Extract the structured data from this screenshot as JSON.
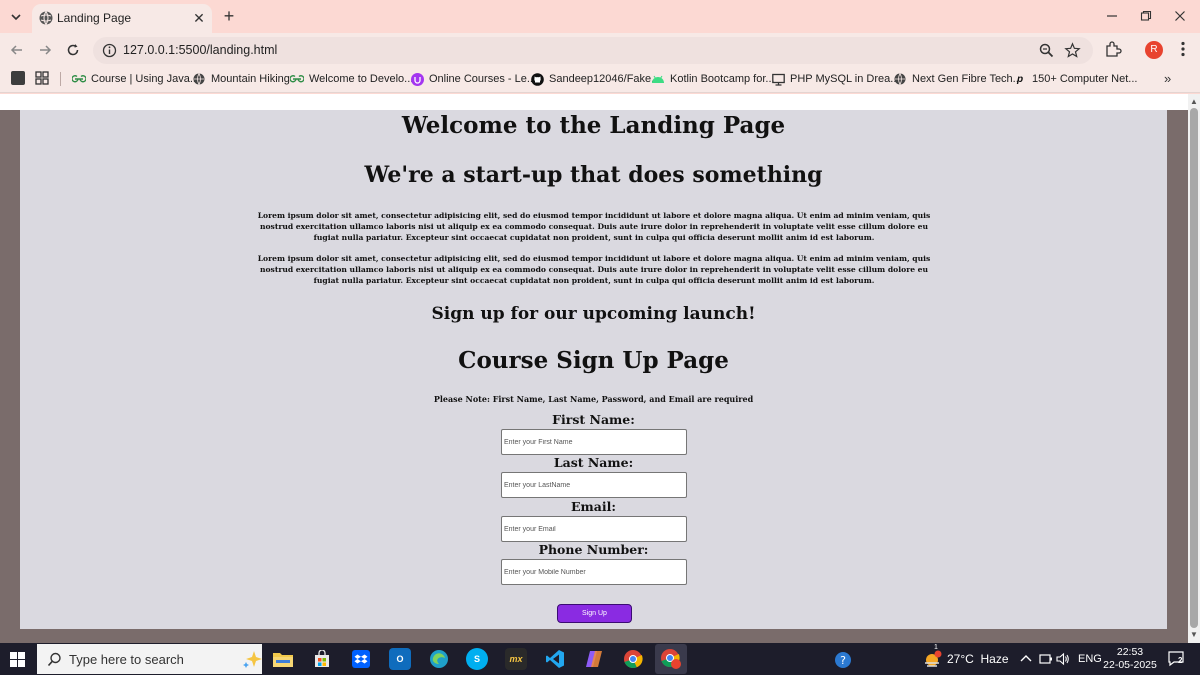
{
  "browser": {
    "tab": {
      "title": "Landing Page"
    },
    "url": "127.0.0.1:5500/landing.html",
    "profile_initial": "R",
    "bookmarks": [
      {
        "label": "Course | Using Java...",
        "icon": "gfg-icon",
        "color": "#2f8d46"
      },
      {
        "label": "Mountain Hiking",
        "icon": "globe-icon",
        "color": "#333333"
      },
      {
        "label": "Welcome to Develo...",
        "icon": "gfg-icon",
        "color": "#2f8d46"
      },
      {
        "label": "Online Courses - Le...",
        "icon": "udemy-icon",
        "color": "#a435f0"
      },
      {
        "label": "Sandeep12046/Fake...",
        "icon": "github-icon",
        "color": "#111111"
      },
      {
        "label": "Kotlin Bootcamp for...",
        "icon": "android-icon",
        "color": "#3ddc84"
      },
      {
        "label": "PHP MySQL in Drea...",
        "icon": "monitor-icon",
        "color": "#333333"
      },
      {
        "label": "Next Gen Fibre Tech...",
        "icon": "globe-icon",
        "color": "#333333"
      },
      {
        "label": "150+ Computer Net...",
        "icon": "p-icon",
        "color": "#111111"
      }
    ],
    "more_bookmarks": "»"
  },
  "page": {
    "heading": "Welcome to the Landing Page",
    "subheading": "We're a start-up that does something",
    "paragraphs": [
      "Lorem ipsum dolor sit amet, consectetur adipisicing elit, sed do eiusmod tempor incididunt ut labore et dolore magna aliqua. Ut enim ad minim veniam, quis nostrud exercitation ullamco laboris nisi ut aliquip ex ea commodo consequat. Duis aute irure dolor in reprehenderit in voluptate velit esse cillum dolore eu fugiat nulla pariatur. Excepteur sint occaecat cupidatat non proident, sunt in culpa qui officia deserunt mollit anim id est laborum.",
      "Lorem ipsum dolor sit amet, consectetur adipisicing elit, sed do eiusmod tempor incididunt ut labore et dolore magna aliqua. Ut enim ad minim veniam, quis nostrud exercitation ullamco laboris nisi ut aliquip ex ea commodo consequat. Duis aute irure dolor in reprehenderit in voluptate velit esse cillum dolore eu fugiat nulla pariatur. Excepteur sint occaecat cupidatat non proident, sunt in culpa qui officia deserunt mollit anim id est laborum."
    ],
    "cta": "Sign up for our upcoming launch!",
    "form_title": "Course Sign Up Page",
    "note": "Please Note: First Name, Last Name, Password, and Email are required",
    "fields": [
      {
        "label": "First Name:",
        "placeholder": "Enter your First Name"
      },
      {
        "label": "Last Name:",
        "placeholder": "Enter your LastName"
      },
      {
        "label": "Email:",
        "placeholder": "Enter your Email"
      },
      {
        "label": "Phone Number:",
        "placeholder": "Enter your Mobile Number"
      }
    ],
    "submit_label": "Sign Up",
    "colors": {
      "background": "#dad9e0",
      "button": "#8a2be2"
    }
  },
  "taskbar": {
    "search_placeholder": "Type here to search",
    "apps": [
      {
        "name": "file-explorer-icon",
        "label": "",
        "color": "#f2c94c"
      },
      {
        "name": "store-icon",
        "label": "",
        "color": "#3f7fd8"
      },
      {
        "name": "dropbox-icon",
        "label": "",
        "color": "#0061fe"
      },
      {
        "name": "outlook-icon",
        "label": "O",
        "color": "#0f6cbd"
      },
      {
        "name": "edge-icon",
        "label": "",
        "color": "#1fa0c9"
      },
      {
        "name": "skype-icon",
        "label": "S",
        "color": "#00aff0"
      },
      {
        "name": "mobaxterm-icon",
        "label": "mx",
        "color": "#2a2a2a"
      },
      {
        "name": "vscode-icon",
        "label": "",
        "color": "#0078d4"
      },
      {
        "name": "copilot-icon",
        "label": "",
        "color": "#8e5cf7"
      },
      {
        "name": "chrome-icon",
        "label": "",
        "color": "#db4437"
      },
      {
        "name": "chrome-profile-icon",
        "label": "",
        "color": "#db4437"
      }
    ],
    "weather": "27°C  Haze",
    "weather_badge": "1",
    "language": "ENG",
    "time": "22:53",
    "date": "22-05-2025",
    "notifications": "2"
  }
}
